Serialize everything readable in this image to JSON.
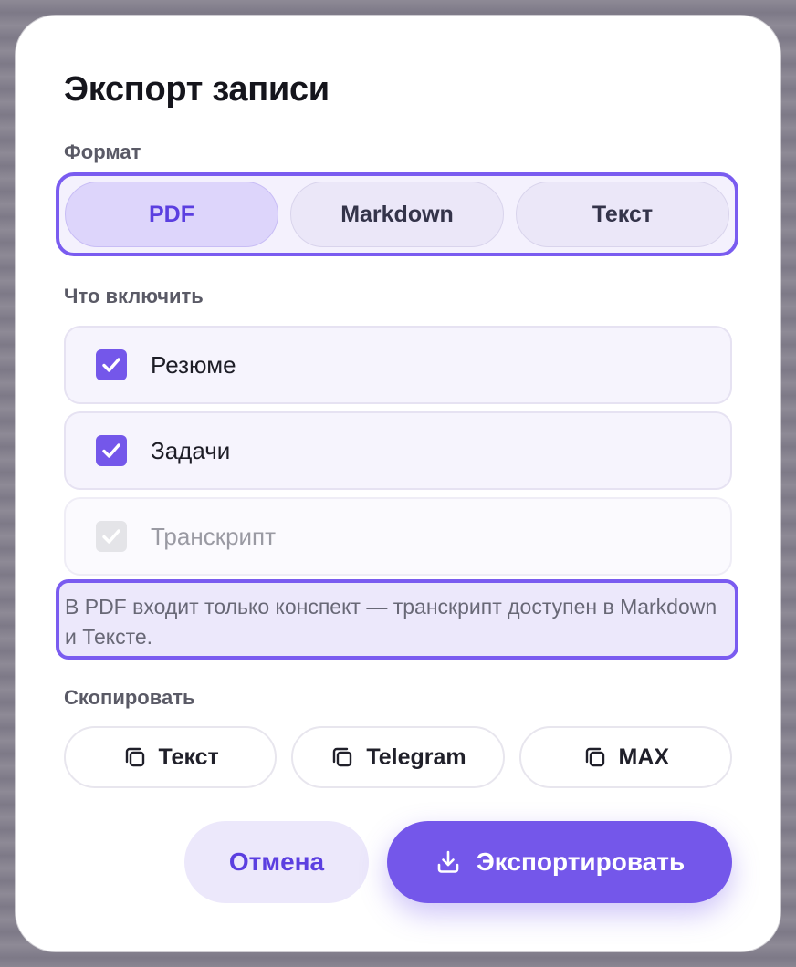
{
  "dialog": {
    "title": "Экспорт записи"
  },
  "format": {
    "label": "Формат",
    "options": [
      "PDF",
      "Markdown",
      "Текст"
    ],
    "selected": "PDF"
  },
  "include": {
    "label": "Что включить",
    "items": [
      {
        "label": "Резюме",
        "checked": true,
        "disabled": false
      },
      {
        "label": "Задачи",
        "checked": true,
        "disabled": false
      },
      {
        "label": "Транскрипт",
        "checked": true,
        "disabled": true
      }
    ],
    "note": "В PDF входит только конспект — транскрипт доступен в Markdown и Тексте."
  },
  "copy": {
    "label": "Скопировать",
    "buttons": [
      {
        "label": "Текст",
        "icon": "copy-icon"
      },
      {
        "label": "Telegram",
        "icon": "copy-icon"
      },
      {
        "label": "MAX",
        "icon": "copy-icon"
      }
    ]
  },
  "actions": {
    "cancel_label": "Отмена",
    "export_label": "Экспортировать",
    "export_icon": "download-icon"
  },
  "colors": {
    "accent": "#7457ea",
    "accent_text": "#5b3fe0",
    "accent_light": "#ece8fb"
  }
}
